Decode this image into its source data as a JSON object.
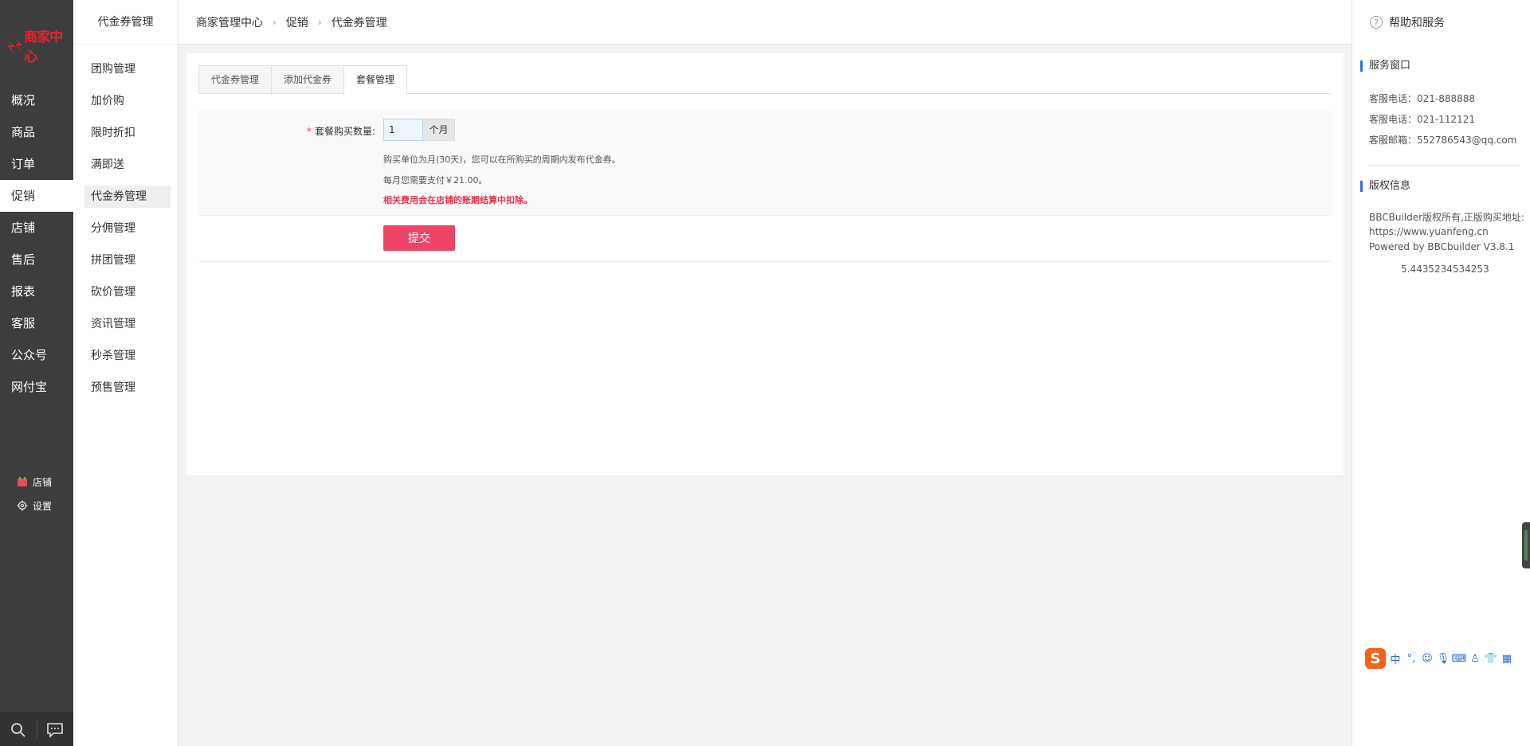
{
  "logo": {
    "text": "商家中心"
  },
  "main_nav": [
    {
      "label": "概况",
      "active": false
    },
    {
      "label": "商品",
      "active": false
    },
    {
      "label": "订单",
      "active": false
    },
    {
      "label": "促销",
      "active": true
    },
    {
      "label": "店铺",
      "active": false
    },
    {
      "label": "售后",
      "active": false
    },
    {
      "label": "报表",
      "active": false
    },
    {
      "label": "客服",
      "active": false
    },
    {
      "label": "公众号",
      "active": false
    },
    {
      "label": "网付宝",
      "active": false
    }
  ],
  "bottom_links": {
    "shop": "店铺",
    "settings": "设置"
  },
  "subnav": {
    "title": "代金券管理",
    "items": [
      {
        "label": "团购管理"
      },
      {
        "label": "加价购"
      },
      {
        "label": "限时折扣"
      },
      {
        "label": "满即送"
      },
      {
        "label": "代金券管理"
      },
      {
        "label": "分佣管理"
      },
      {
        "label": "拼团管理"
      },
      {
        "label": "砍价管理"
      },
      {
        "label": "资讯管理"
      },
      {
        "label": "秒杀管理"
      },
      {
        "label": "预售管理"
      }
    ]
  },
  "breadcrumb": [
    "商家管理中心",
    "促销",
    "代金券管理"
  ],
  "tabs": [
    {
      "label": "代金券管理"
    },
    {
      "label": "添加代金券"
    },
    {
      "label": "套餐管理"
    }
  ],
  "form": {
    "required_mark": "*",
    "qty_label": "套餐购买数量:",
    "qty_value": "1",
    "qty_unit": "个月",
    "hint1": "购买单位为月(30天)，您可以在所购买的周期内发布代金券。",
    "hint2": "每月您需要支付￥21.00。",
    "hint3": "相关费用会在店铺的账期结算中扣除。",
    "submit": "提交"
  },
  "help_panel": {
    "title": "帮助和服务",
    "service_title": "服务窗口",
    "phone1": "客服电话：021-888888",
    "phone2": "客服电话：021-112121",
    "email": "客服邮箱：552786543@qq.com",
    "copyright_title": "版权信息",
    "copyright1": "BBCBuilder版权所有,正版购买地址:",
    "copyright2": "https://www.yuanfeng.cn",
    "copyright3": "Powered by BBCbuilder V3.8.1",
    "load_time": "5.4435234534253"
  },
  "ime": {
    "mode": "中"
  },
  "colors": {
    "accent_red": "#ee4466",
    "nav_bg": "#3d3d3d",
    "blue_bar": "#2f71d6"
  }
}
